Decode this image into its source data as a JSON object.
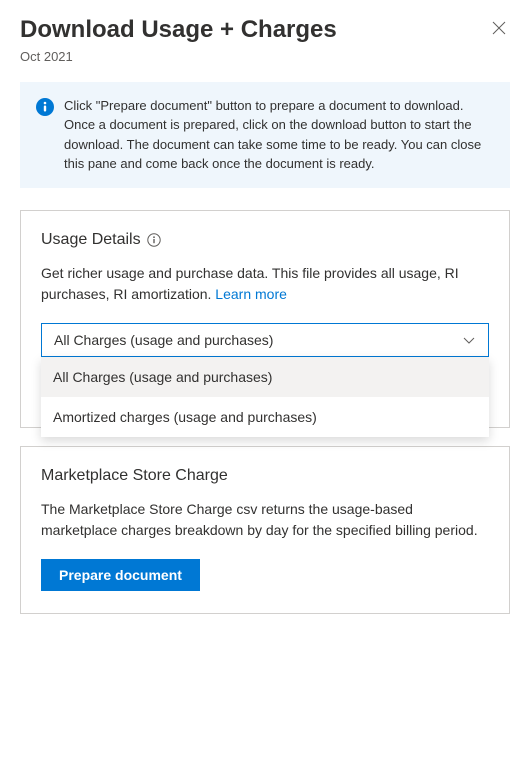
{
  "header": {
    "title": "Download Usage + Charges",
    "period": "Oct 2021"
  },
  "info_banner": {
    "text": "Click \"Prepare document\" button to prepare a document to download. Once a document is prepared, click on the download button to start the download. The document can take some time to be ready. You can close this pane and come back once the document is ready."
  },
  "usage_details": {
    "title": "Usage Details",
    "description": "Get richer usage and purchase data. This file provides all usage, RI purchases, RI amortization. ",
    "learn_more_label": "Learn more",
    "dropdown": {
      "selected": "All Charges (usage and purchases)",
      "options": [
        "All Charges (usage and purchases)",
        "Amortized charges (usage and purchases)"
      ]
    }
  },
  "marketplace": {
    "title": "Marketplace Store Charge",
    "description": "The Marketplace Store Charge csv returns the usage-based marketplace charges breakdown by day for the specified billing period.",
    "prepare_button_label": "Prepare document"
  }
}
